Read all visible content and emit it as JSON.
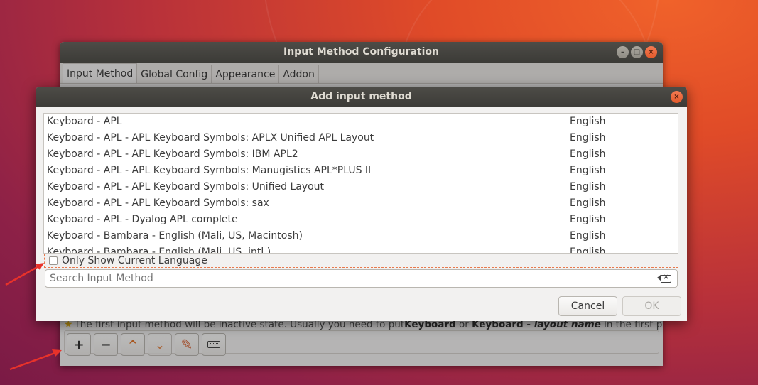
{
  "back_window": {
    "title": "Input Method Configuration",
    "tabs": [
      {
        "label": "Input Method"
      },
      {
        "label": "Global Config"
      },
      {
        "label": "Appearance"
      },
      {
        "label": "Addon"
      }
    ],
    "hint_prefix": "The first input method will be inactive state. Usually you need to put ",
    "hint_bold_1": "Keyboard",
    "hint_mid": " or ",
    "hint_bold_2": "Keyboard - ",
    "hint_bold_italic": "layout name",
    "hint_suffix": " in the first place.",
    "toolbar": {
      "add_label": "+",
      "remove_label": "−",
      "up_label": "^",
      "down_label": "⌄"
    }
  },
  "dialog": {
    "title": "Add input method",
    "rows": [
      {
        "name": "Keyboard - APL",
        "lang": "English"
      },
      {
        "name": "Keyboard - APL - APL Keyboard Symbols: APLX Unified APL Layout",
        "lang": "English"
      },
      {
        "name": "Keyboard - APL - APL Keyboard Symbols: IBM APL2",
        "lang": "English"
      },
      {
        "name": "Keyboard - APL - APL Keyboard Symbols: Manugistics APL*PLUS II",
        "lang": "English"
      },
      {
        "name": "Keyboard - APL - APL Keyboard Symbols: Unified Layout",
        "lang": "English"
      },
      {
        "name": "Keyboard - APL - APL Keyboard Symbols: sax",
        "lang": "English"
      },
      {
        "name": "Keyboard - APL - Dyalog APL complete",
        "lang": "English"
      },
      {
        "name": "Keyboard - Bambara - English (Mali, US, Macintosh)",
        "lang": "English"
      },
      {
        "name": "Keyboard - Bambara - English (Mali, US, intl.)",
        "lang": "English"
      }
    ],
    "checkbox_label": "Only Show Current Language",
    "checkbox_checked": false,
    "search_placeholder": "Search Input Method",
    "cancel_label": "Cancel",
    "ok_label": "OK"
  },
  "colors": {
    "titlebar": "#3c3b37",
    "close_button": "#e35a2b",
    "arrow": "#e8322a"
  }
}
